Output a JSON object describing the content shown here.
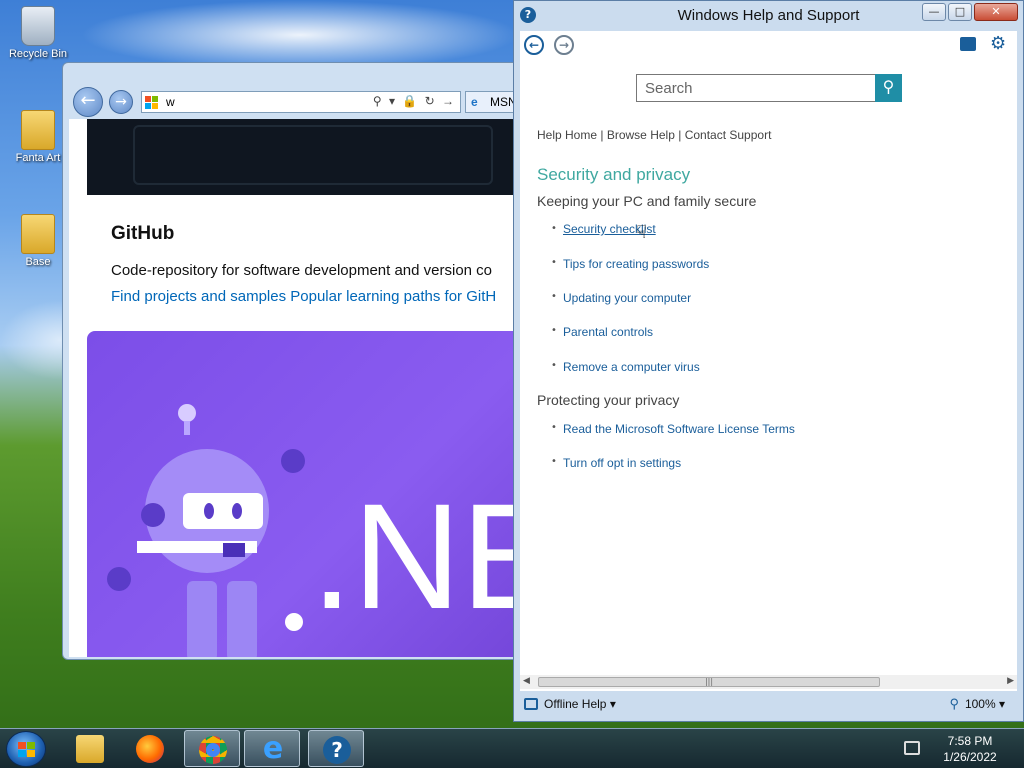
{
  "desktop": {
    "icons": [
      {
        "label": "Recycle Bin",
        "icon": "recycle-bin-icon"
      },
      {
        "label": "Fanta Art",
        "icon": "folder-icon"
      },
      {
        "label": "Base",
        "icon": "folder-icon"
      }
    ]
  },
  "browser": {
    "address_text": "w",
    "tab_label": "MSN",
    "github_title": "GitHub",
    "github_desc": "Code-repository for software development and version co",
    "github_links": "Find projects and samples Popular learning paths for GitH",
    "banner_text": ".NE"
  },
  "help": {
    "window_title": "Windows Help and Support",
    "search_placeholder": "Search",
    "breadcrumbs": {
      "home": "Help Home",
      "browse": "Browse Help",
      "contact": "Contact Support",
      "sep": "|"
    },
    "section_title": "Security and privacy",
    "group1_title": "Keeping your PC and family secure",
    "group1_links": [
      "Security checklist",
      "Tips for creating passwords",
      "Updating your computer",
      "Parental controls",
      "Remove a computer virus"
    ],
    "group2_title": "Protecting your privacy",
    "group2_links": [
      "Read the Microsoft Software License Terms",
      "Turn off opt in settings"
    ],
    "status_offline": "Offline Help",
    "zoom": "100%",
    "accent_color": "#3fa8a0",
    "link_color": "#1a5e9a"
  },
  "taskbar": {
    "items": [
      "file-explorer-icon",
      "firefox-icon",
      "chrome-icon",
      "internet-explorer-icon",
      "help-icon"
    ],
    "time": "7:58 PM",
    "date": "1/26/2022"
  }
}
